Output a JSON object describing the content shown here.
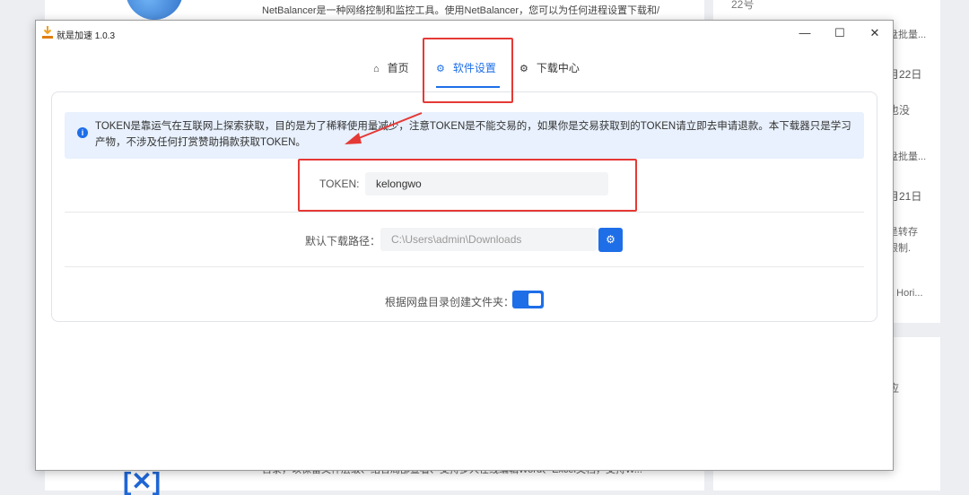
{
  "background": {
    "top_text": "NetBalancer是一种网络控制和监控工具。使用NetBalancer，您可以为任何进程设置下载和/",
    "bottom_text": "目录，以保留文件层级、结合局部查看、支持多人在线编辑Word、Excel文档，支持W...",
    "top_date_text": "22号",
    "right_items": [
      "盘批量...",
      "月22日",
      "也没",
      "盘批量...",
      "月21日",
      "是转存",
      "限制.",
      "a Hori...",
      "应"
    ]
  },
  "app": {
    "title": "就是加速  1.0.3",
    "window_buttons": {
      "minimize": "—",
      "maximize": "☐",
      "close": "✕"
    }
  },
  "nav": {
    "home": {
      "label": "首页",
      "icon": "home-icon"
    },
    "settings": {
      "label": "软件设置",
      "icon": "gear-icon"
    },
    "downloads": {
      "label": "下载中心",
      "icon": "gear-icon"
    }
  },
  "alert": {
    "icon": "info-icon",
    "text": "TOKEN是靠运气在互联网上探索获取，目的是为了稀释使用量减少，注意TOKEN是不能交易的，如果你是交易获取到的TOKEN请立即去申请退款。本下载器只是学习产物，不涉及任何打赏赞助捐款获取TOKEN。"
  },
  "settings": {
    "token_label": "TOKEN:",
    "token_value": "kelongwo",
    "path_label": "默认下载路径：",
    "path_value": "C:\\Users\\admin\\Downloads",
    "folder_toggle_label": "根据网盘目录创建文件夹：",
    "folder_toggle_on": true
  },
  "colors": {
    "accent": "#1e6ee8",
    "highlight": "#e53935",
    "alert_bg": "#e8f1fd"
  }
}
